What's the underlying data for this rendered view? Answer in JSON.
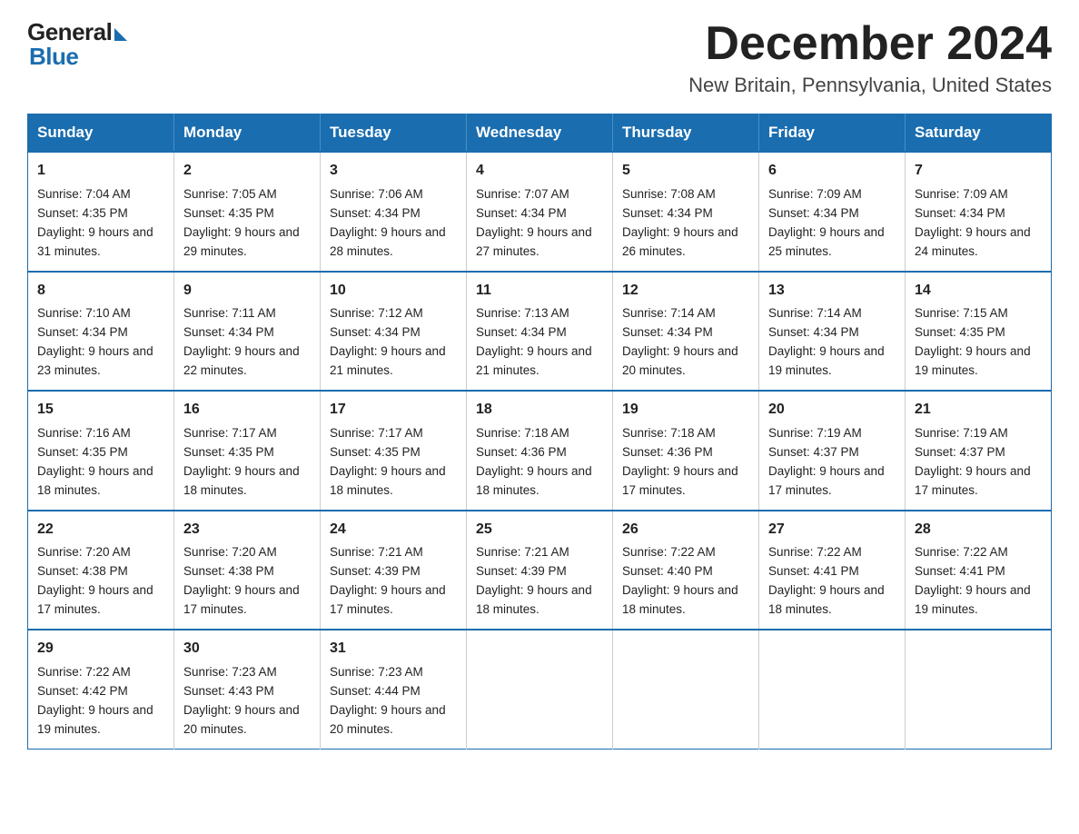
{
  "logo": {
    "general": "General",
    "blue": "Blue"
  },
  "header": {
    "month": "December 2024",
    "location": "New Britain, Pennsylvania, United States"
  },
  "days_of_week": [
    "Sunday",
    "Monday",
    "Tuesday",
    "Wednesday",
    "Thursday",
    "Friday",
    "Saturday"
  ],
  "weeks": [
    [
      {
        "day": "1",
        "sunrise": "7:04 AM",
        "sunset": "4:35 PM",
        "daylight": "9 hours and 31 minutes."
      },
      {
        "day": "2",
        "sunrise": "7:05 AM",
        "sunset": "4:35 PM",
        "daylight": "9 hours and 29 minutes."
      },
      {
        "day": "3",
        "sunrise": "7:06 AM",
        "sunset": "4:34 PM",
        "daylight": "9 hours and 28 minutes."
      },
      {
        "day": "4",
        "sunrise": "7:07 AM",
        "sunset": "4:34 PM",
        "daylight": "9 hours and 27 minutes."
      },
      {
        "day": "5",
        "sunrise": "7:08 AM",
        "sunset": "4:34 PM",
        "daylight": "9 hours and 26 minutes."
      },
      {
        "day": "6",
        "sunrise": "7:09 AM",
        "sunset": "4:34 PM",
        "daylight": "9 hours and 25 minutes."
      },
      {
        "day": "7",
        "sunrise": "7:09 AM",
        "sunset": "4:34 PM",
        "daylight": "9 hours and 24 minutes."
      }
    ],
    [
      {
        "day": "8",
        "sunrise": "7:10 AM",
        "sunset": "4:34 PM",
        "daylight": "9 hours and 23 minutes."
      },
      {
        "day": "9",
        "sunrise": "7:11 AM",
        "sunset": "4:34 PM",
        "daylight": "9 hours and 22 minutes."
      },
      {
        "day": "10",
        "sunrise": "7:12 AM",
        "sunset": "4:34 PM",
        "daylight": "9 hours and 21 minutes."
      },
      {
        "day": "11",
        "sunrise": "7:13 AM",
        "sunset": "4:34 PM",
        "daylight": "9 hours and 21 minutes."
      },
      {
        "day": "12",
        "sunrise": "7:14 AM",
        "sunset": "4:34 PM",
        "daylight": "9 hours and 20 minutes."
      },
      {
        "day": "13",
        "sunrise": "7:14 AM",
        "sunset": "4:34 PM",
        "daylight": "9 hours and 19 minutes."
      },
      {
        "day": "14",
        "sunrise": "7:15 AM",
        "sunset": "4:35 PM",
        "daylight": "9 hours and 19 minutes."
      }
    ],
    [
      {
        "day": "15",
        "sunrise": "7:16 AM",
        "sunset": "4:35 PM",
        "daylight": "9 hours and 18 minutes."
      },
      {
        "day": "16",
        "sunrise": "7:17 AM",
        "sunset": "4:35 PM",
        "daylight": "9 hours and 18 minutes."
      },
      {
        "day": "17",
        "sunrise": "7:17 AM",
        "sunset": "4:35 PM",
        "daylight": "9 hours and 18 minutes."
      },
      {
        "day": "18",
        "sunrise": "7:18 AM",
        "sunset": "4:36 PM",
        "daylight": "9 hours and 18 minutes."
      },
      {
        "day": "19",
        "sunrise": "7:18 AM",
        "sunset": "4:36 PM",
        "daylight": "9 hours and 17 minutes."
      },
      {
        "day": "20",
        "sunrise": "7:19 AM",
        "sunset": "4:37 PM",
        "daylight": "9 hours and 17 minutes."
      },
      {
        "day": "21",
        "sunrise": "7:19 AM",
        "sunset": "4:37 PM",
        "daylight": "9 hours and 17 minutes."
      }
    ],
    [
      {
        "day": "22",
        "sunrise": "7:20 AM",
        "sunset": "4:38 PM",
        "daylight": "9 hours and 17 minutes."
      },
      {
        "day": "23",
        "sunrise": "7:20 AM",
        "sunset": "4:38 PM",
        "daylight": "9 hours and 17 minutes."
      },
      {
        "day": "24",
        "sunrise": "7:21 AM",
        "sunset": "4:39 PM",
        "daylight": "9 hours and 17 minutes."
      },
      {
        "day": "25",
        "sunrise": "7:21 AM",
        "sunset": "4:39 PM",
        "daylight": "9 hours and 18 minutes."
      },
      {
        "day": "26",
        "sunrise": "7:22 AM",
        "sunset": "4:40 PM",
        "daylight": "9 hours and 18 minutes."
      },
      {
        "day": "27",
        "sunrise": "7:22 AM",
        "sunset": "4:41 PM",
        "daylight": "9 hours and 18 minutes."
      },
      {
        "day": "28",
        "sunrise": "7:22 AM",
        "sunset": "4:41 PM",
        "daylight": "9 hours and 19 minutes."
      }
    ],
    [
      {
        "day": "29",
        "sunrise": "7:22 AM",
        "sunset": "4:42 PM",
        "daylight": "9 hours and 19 minutes."
      },
      {
        "day": "30",
        "sunrise": "7:23 AM",
        "sunset": "4:43 PM",
        "daylight": "9 hours and 20 minutes."
      },
      {
        "day": "31",
        "sunrise": "7:23 AM",
        "sunset": "4:44 PM",
        "daylight": "9 hours and 20 minutes."
      },
      null,
      null,
      null,
      null
    ]
  ],
  "labels": {
    "sunrise": "Sunrise: ",
    "sunset": "Sunset: ",
    "daylight": "Daylight: "
  }
}
